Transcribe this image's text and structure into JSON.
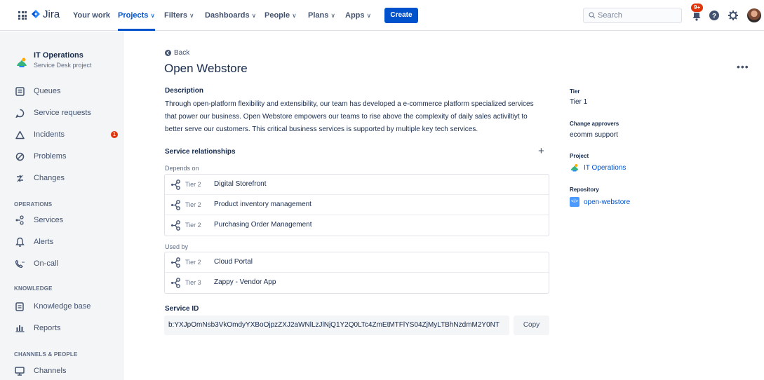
{
  "topnav": {
    "logo_text": "Jira",
    "items": [
      {
        "label": "Your work"
      },
      {
        "label": "Projects"
      },
      {
        "label": "Filters"
      },
      {
        "label": "Dashboards"
      },
      {
        "label": "People"
      },
      {
        "label": "Plans"
      },
      {
        "label": "Apps"
      }
    ],
    "create_label": "Create",
    "search_placeholder": "Search",
    "notifications_badge": "9+",
    "accent_color": "#0052CC"
  },
  "sidebar": {
    "project_name": "IT Operations",
    "project_type": "Service Desk project",
    "items": [
      {
        "label": "Queues",
        "icon": "queues-icon"
      },
      {
        "label": "Service requests",
        "icon": "chat-icon"
      },
      {
        "label": "Incidents",
        "icon": "warning-triangle-icon",
        "count": "1"
      },
      {
        "label": "Problems",
        "icon": "problem-icon"
      },
      {
        "label": "Changes",
        "icon": "changes-icon"
      }
    ],
    "sections": [
      {
        "heading": "OPERATIONS",
        "items": [
          {
            "label": "Services",
            "icon": "services-icon"
          },
          {
            "label": "Alerts",
            "icon": "bell-icon"
          },
          {
            "label": "On-call",
            "icon": "on-call-icon"
          }
        ]
      },
      {
        "heading": "KNOWLEDGE",
        "items": [
          {
            "label": "Knowledge base",
            "icon": "knowledge-icon"
          },
          {
            "label": "Reports",
            "icon": "reports-icon"
          }
        ]
      },
      {
        "heading": "CHANNELS & PEOPLE",
        "items": [
          {
            "label": "Channels",
            "icon": "monitor-icon"
          }
        ]
      }
    ]
  },
  "main": {
    "back_label": "Back",
    "title": "Open Webstore",
    "description_heading": "Description",
    "description": "Through open-platform flexibility and extensibility, our team has developed a e-commerce platform specialized services that power our business. Open Webstore empowers our teams to rise above the complexity of daily sales activiltiyt to better serve our customers. This critical business services is supported by multiple key tech services.",
    "relationships_heading": "Service relationships",
    "depends_on_label": "Depends on",
    "depends_on": [
      {
        "tier": "Tier 2",
        "name": "Digital Storefront"
      },
      {
        "tier": "Tier 2",
        "name": "Product inventory management"
      },
      {
        "tier": "Tier 2",
        "name": "Purchasing Order Management"
      }
    ],
    "used_by_label": "Used by",
    "used_by": [
      {
        "tier": "Tier 2",
        "name": "Cloud Portal"
      },
      {
        "tier": "Tier 3",
        "name": "Zappy - Vendor App"
      }
    ],
    "service_id_heading": "Service ID",
    "service_id": "b:YXJpOmNsb3VkOmdyYXBoOjpzZXJ2aWNlLzJlNjQ1Y2Q0LTc4ZmEtMTFlYS04ZjMyLTBhNzdmM2Y0NT",
    "copy_label": "Copy"
  },
  "details": {
    "tier_label": "Tier",
    "tier_value": "Tier 1",
    "approvers_label": "Change approvers",
    "approvers_value": "ecomm support",
    "project_label": "Project",
    "project_value": "IT Operations",
    "repository_label": "Repository",
    "repository_value": "open-webstore"
  }
}
